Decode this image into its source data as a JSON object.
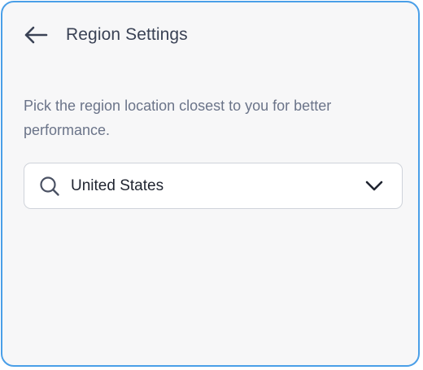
{
  "header": {
    "title": "Region Settings",
    "back_icon": "arrow-left-icon"
  },
  "description": "Pick the region location closest to you for better performance.",
  "region_select": {
    "value": "United States",
    "search_icon": "search-icon",
    "dropdown_icon": "chevron-down-icon"
  },
  "colors": {
    "border_accent": "#4a9fe8",
    "panel_background": "#f7f7f8",
    "title_text": "#3a4255",
    "description_text": "#6b7489"
  }
}
